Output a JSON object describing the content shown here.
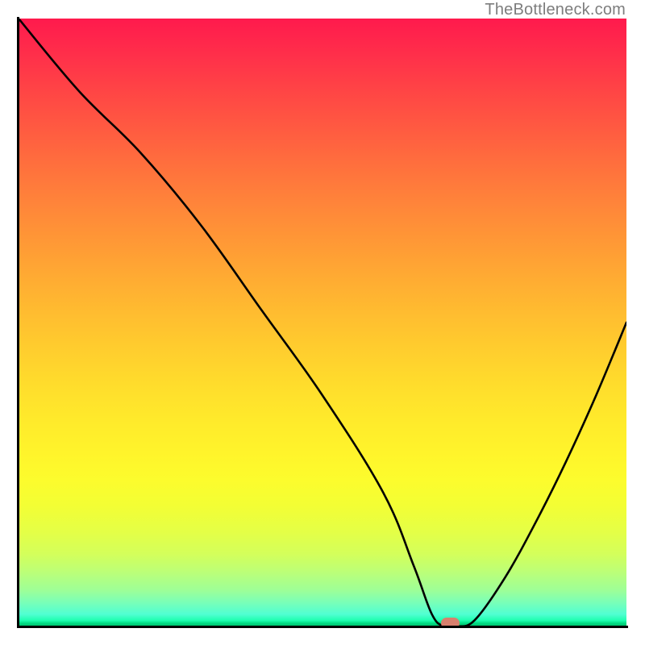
{
  "watermark": "TheBottleneck.com",
  "colors": {
    "curve": "#000000",
    "axis": "#000000",
    "marker": "#d8806e",
    "watermark_text": "#7d7d7d"
  },
  "chart_data": {
    "type": "line",
    "title": "",
    "xlabel": "",
    "ylabel": "",
    "xlim": [
      0,
      100
    ],
    "ylim": [
      0,
      100
    ],
    "grid": false,
    "series": [
      {
        "name": "bottleneck-curve",
        "x": [
          0,
          10,
          20,
          30,
          40,
          50,
          60,
          65,
          68,
          70,
          72,
          75,
          80,
          85,
          90,
          95,
          100
        ],
        "values": [
          100,
          88,
          78,
          66,
          52,
          38,
          22,
          10,
          2,
          0,
          0,
          1,
          8,
          17,
          27,
          38,
          50
        ]
      }
    ],
    "annotations": [
      {
        "name": "optimum-marker",
        "x": 71,
        "y": 0.5
      }
    ]
  }
}
